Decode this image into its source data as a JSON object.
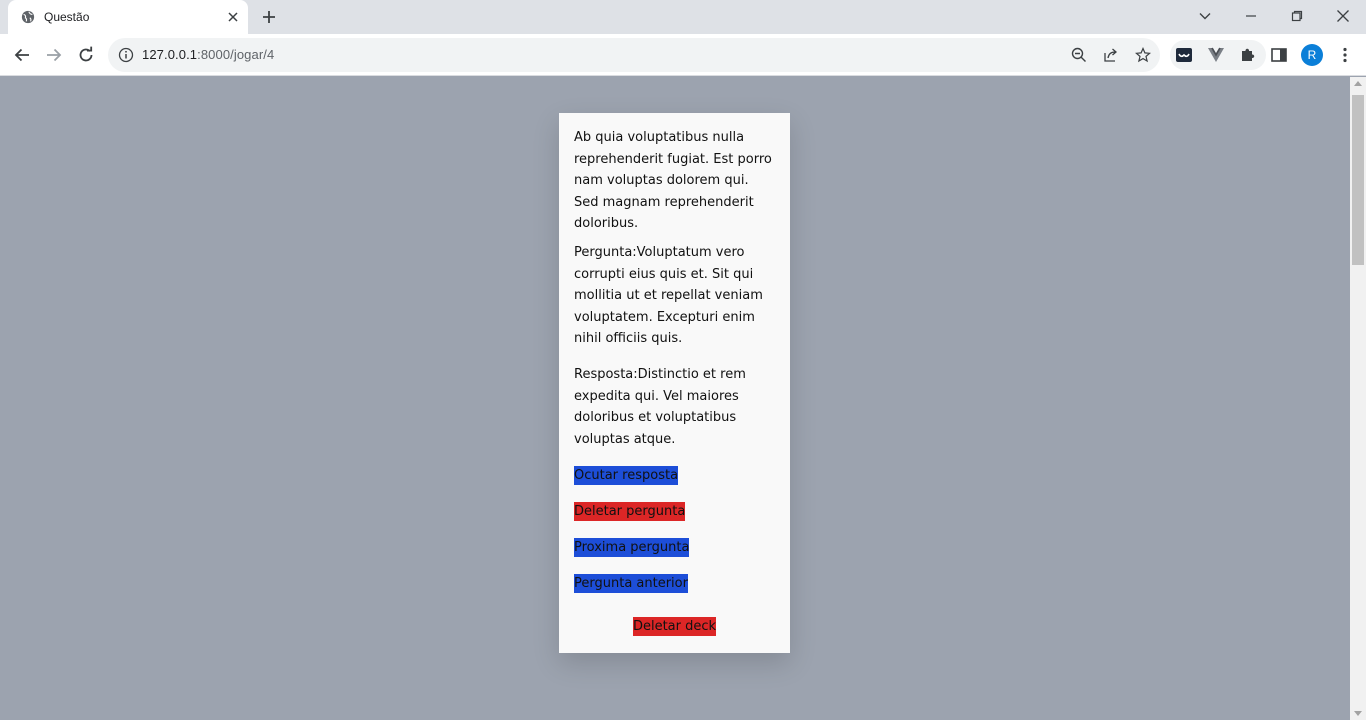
{
  "browser": {
    "tab_title": "Questão",
    "url_host": "127.0.0.1",
    "url_path": ":8000/jogar/4",
    "avatar_letter": "R",
    "icons": {
      "favicon": "globe-icon",
      "tab_close": "close-icon",
      "new_tab": "plus-icon",
      "back": "arrow-left-icon",
      "forward": "arrow-right-icon",
      "reload": "reload-icon",
      "site_info": "info-icon",
      "zoom": "zoom-icon",
      "share": "share-icon",
      "bookmark": "star-icon",
      "extension_1": "extension-icon",
      "extension_2": "vue-icon",
      "extensions": "puzzle-icon",
      "side_panel": "side-panel-icon",
      "menu": "kebab-menu-icon"
    }
  },
  "card": {
    "description": "Ab quia voluptatibus nulla reprehenderit fugiat. Est porro nam voluptas dolorem qui. Sed magnam reprehenderit doloribus.",
    "question": "Pergunta:Voluptatum vero corrupti eius quis et. Sit qui mollitia ut et repellat veniam voluptatem. Excepturi enim nihil officiis quis.",
    "answer": "Resposta:Distinctio et rem expedita qui. Vel maiores doloribus et voluptatibus voluptas atque.",
    "buttons": {
      "hide_answer": "Ocutar resposta",
      "delete_question": "Deletar pergunta",
      "next_question": "Proxima pergunta",
      "previous_question": "Pergunta anterior",
      "delete_deck": "Deletar deck"
    }
  },
  "colors": {
    "page_bg": "#9ca3af",
    "card_bg": "#f9f9f9",
    "button_blue": "#1d4ed8",
    "button_red": "#dc2626"
  }
}
